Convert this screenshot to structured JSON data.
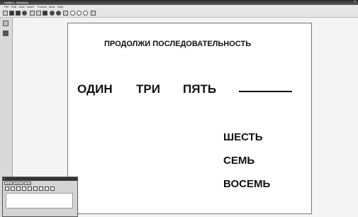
{
  "window": {
    "title": "Untitled - Notebook"
  },
  "menu": {
    "items": [
      "File",
      "Edit",
      "View",
      "Insert",
      "Format",
      "Tools",
      "Help"
    ]
  },
  "palette": {
    "tabs": [
      "Draw",
      "Select",
      "Text"
    ]
  },
  "worksheet": {
    "title": "ПРОДОЛЖИ ПОСЛЕДОВАТЕЛЬНОСТЬ",
    "sequence": [
      "ОДИН",
      "ТРИ",
      "ПЯТЬ"
    ],
    "options": [
      "ШЕСТЬ",
      "СЕМЬ",
      "ВОСЕМЬ"
    ]
  }
}
